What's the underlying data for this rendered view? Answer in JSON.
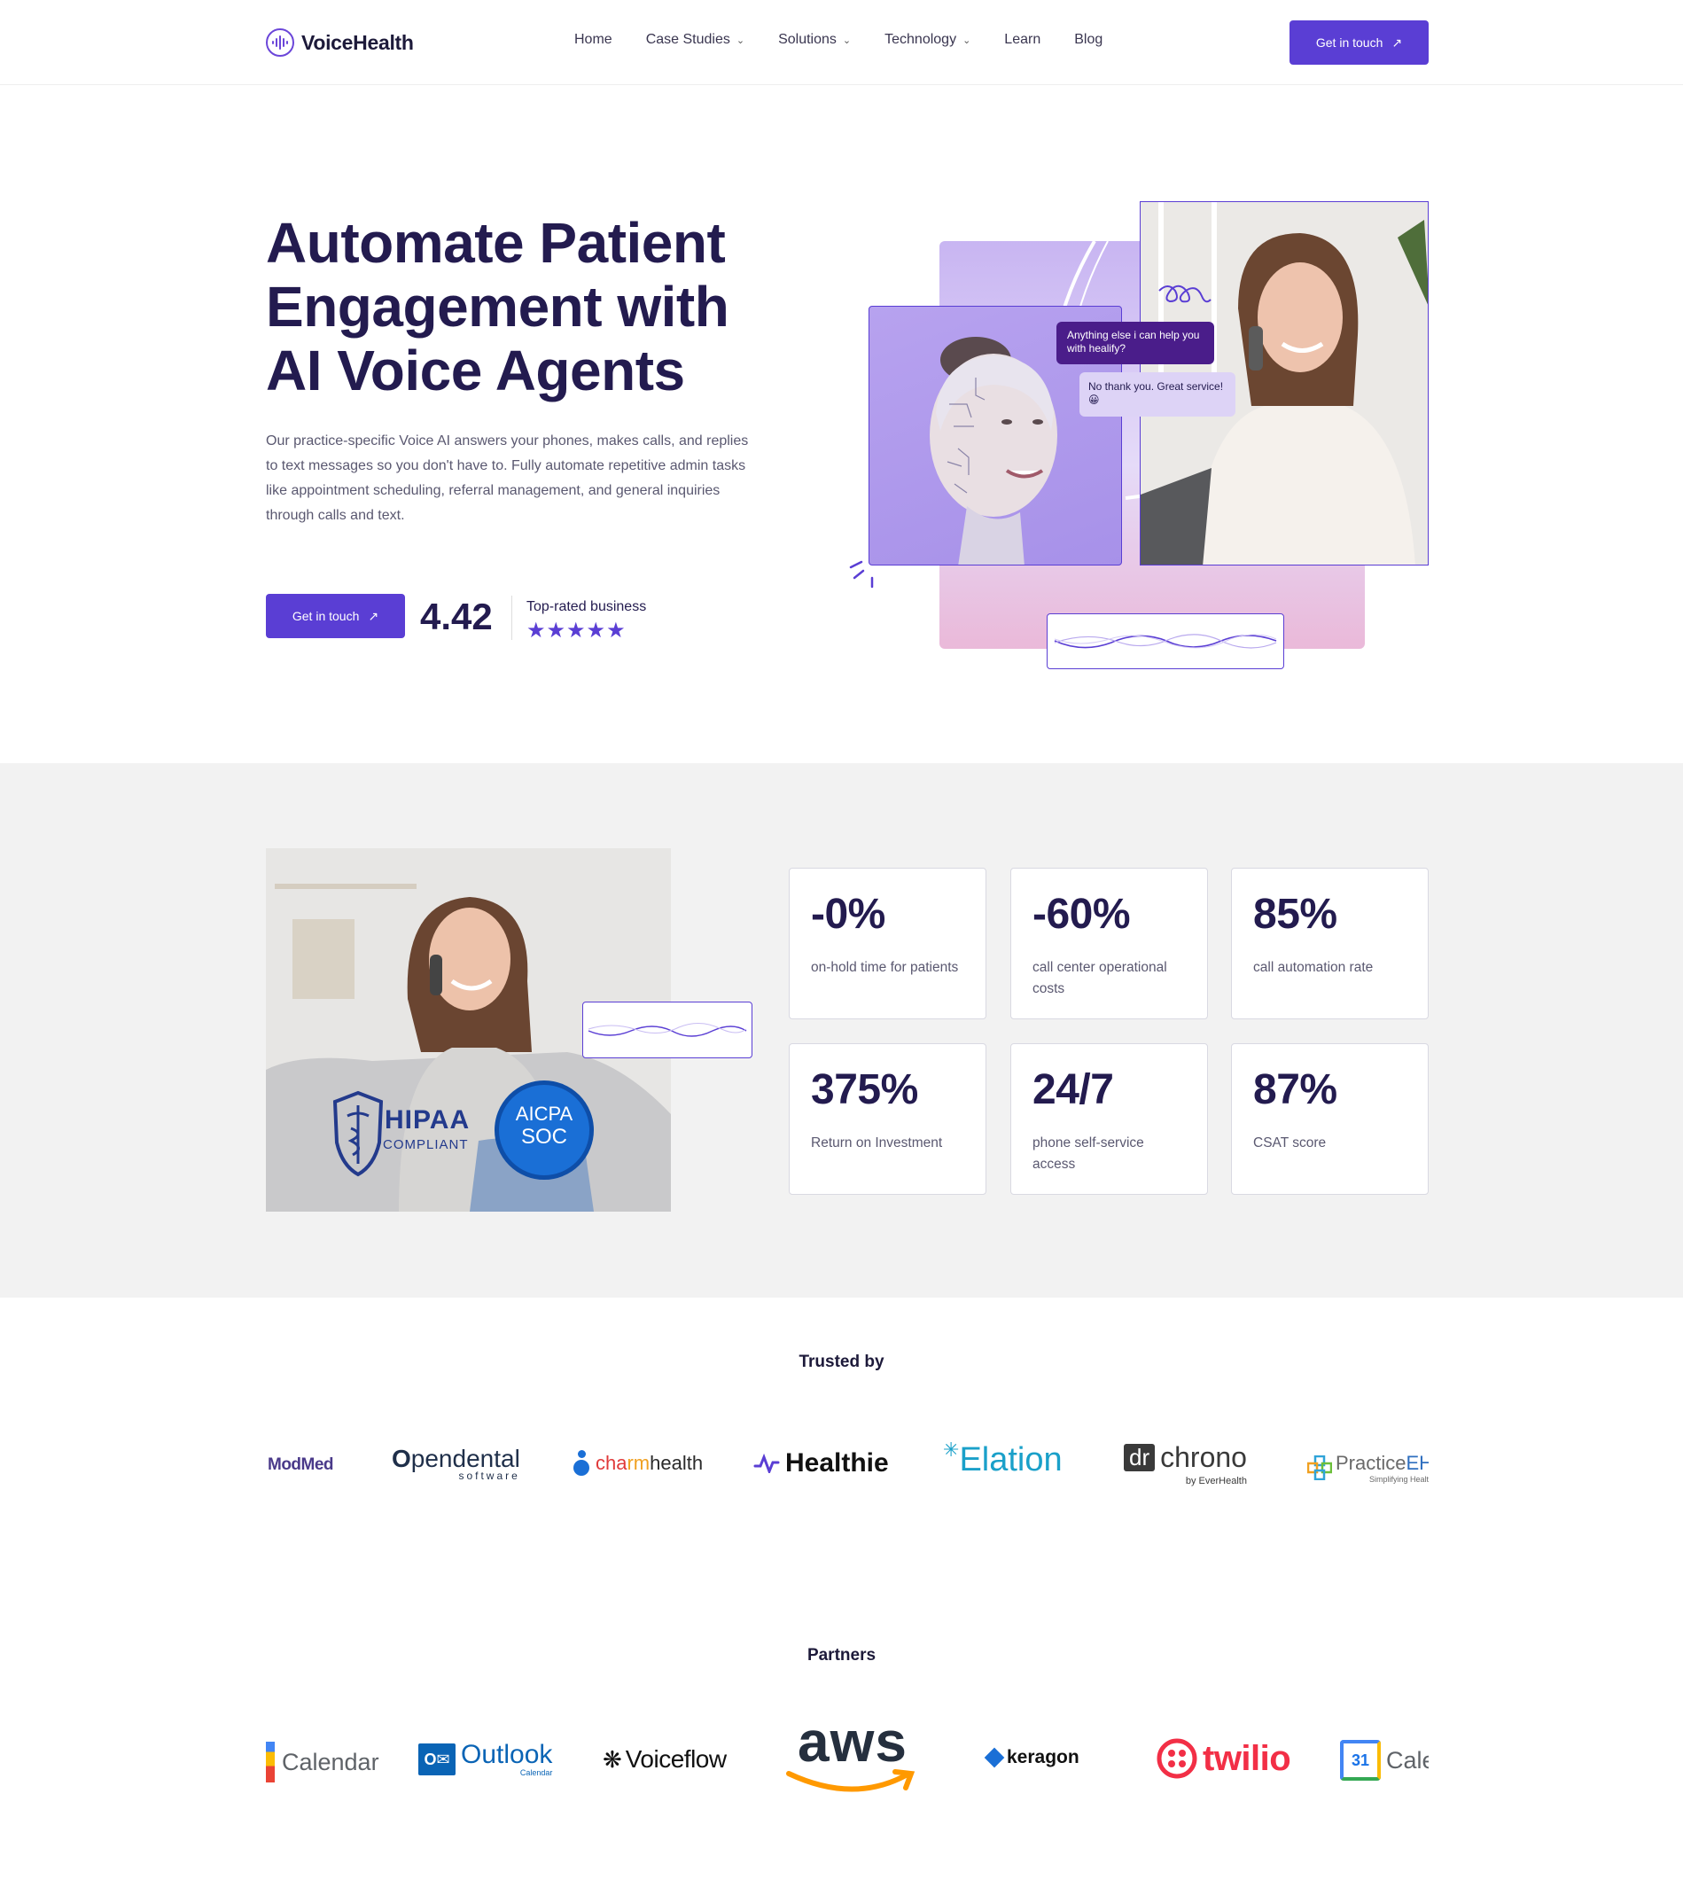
{
  "brand": {
    "name": "VoiceHealth"
  },
  "nav": [
    {
      "label": "Home",
      "dropdown": false
    },
    {
      "label": "Case Studies",
      "dropdown": true
    },
    {
      "label": "Solutions",
      "dropdown": true
    },
    {
      "label": "Technology",
      "dropdown": true
    },
    {
      "label": "Learn",
      "dropdown": false
    },
    {
      "label": "Blog",
      "dropdown": false
    }
  ],
  "header": {
    "cta": "Get in touch"
  },
  "hero": {
    "title_line1": "Automate Patient",
    "title_line2": "Engagement with",
    "title_line3": "AI Voice Agents",
    "description": "Our practice-specific Voice AI answers your phones, makes calls, and replies to text messages so you don't have to. Fully automate repetitive admin tasks like appointment scheduling, referral management, and general inquiries through calls and text.",
    "cta": "Get in touch",
    "rating": "4.42",
    "rating_label": "Top-rated business",
    "stars": 5,
    "chat_agent": "Anything else i can help you with healify?",
    "chat_patient": "No thank you. Great service! 😀"
  },
  "badges": {
    "hipaa_main": "HIPAA",
    "hipaa_sub": "COMPLIANT",
    "aicpa_top": "AICPA",
    "aicpa_mid": "SOC"
  },
  "stats": [
    {
      "value": "-0%",
      "label": "on-hold time for patients"
    },
    {
      "value": "-60%",
      "label": "call center operational costs"
    },
    {
      "value": "85%",
      "label": "call automation rate"
    },
    {
      "value": "375%",
      "label": "Return on Investment"
    },
    {
      "value": "24/7",
      "label": "phone self-service access"
    },
    {
      "value": "87%",
      "label": "CSAT score"
    }
  ],
  "trusted": {
    "title": "Trusted by",
    "logos": {
      "modmed": "ModMed",
      "opendental_a": "O",
      "opendental_b": "pendental",
      "opendental_sub": "software",
      "charm_a": "cha",
      "charm_b": "rm",
      "charm_c": "health",
      "healthie": "Healthie",
      "elation": "Elation",
      "drchrono_dr": "dr",
      "drchrono_name": "chrono",
      "drchrono_sub": "by EverHealth",
      "practice_a": "Practice",
      "practice_b": "EH",
      "practice_sub": "Simplifying Health"
    }
  },
  "partners": {
    "title": "Partners",
    "logos": {
      "gcal_left": "Calendar",
      "outlook": "Outlook",
      "outlook_sub": "Calendar",
      "voiceflow": "Voiceflow",
      "aws": "aws",
      "keragon": "keragon",
      "twilio": "twilio",
      "gcal_right_num": "31",
      "gcal_right": "Cale"
    }
  },
  "colors": {
    "accent": "#5a3ed4",
    "heading": "#231b4f",
    "band": "#f2f2f2"
  }
}
